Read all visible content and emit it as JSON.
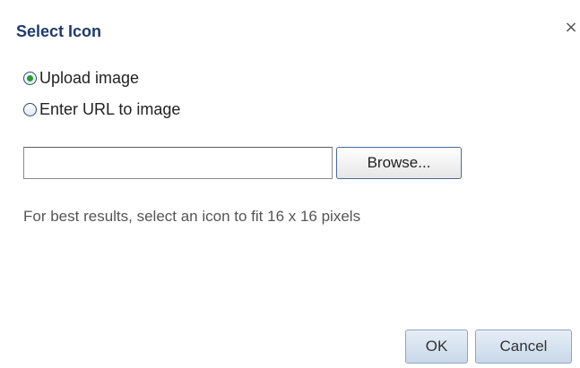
{
  "dialog": {
    "title": "Select Icon",
    "close_label": "×"
  },
  "options": {
    "upload_label": "Upload image",
    "url_label": "Enter URL to image",
    "selected": "upload"
  },
  "file_input": {
    "value": ""
  },
  "browse_label": "Browse...",
  "hint": "For best results, select an icon to fit 16 x 16 pixels",
  "buttons": {
    "ok_label": "OK",
    "cancel_label": "Cancel"
  },
  "colors": {
    "title": "#1e3a6e",
    "radio_dot": "#2a9a2e",
    "button_bg": "#c9d8e9"
  }
}
